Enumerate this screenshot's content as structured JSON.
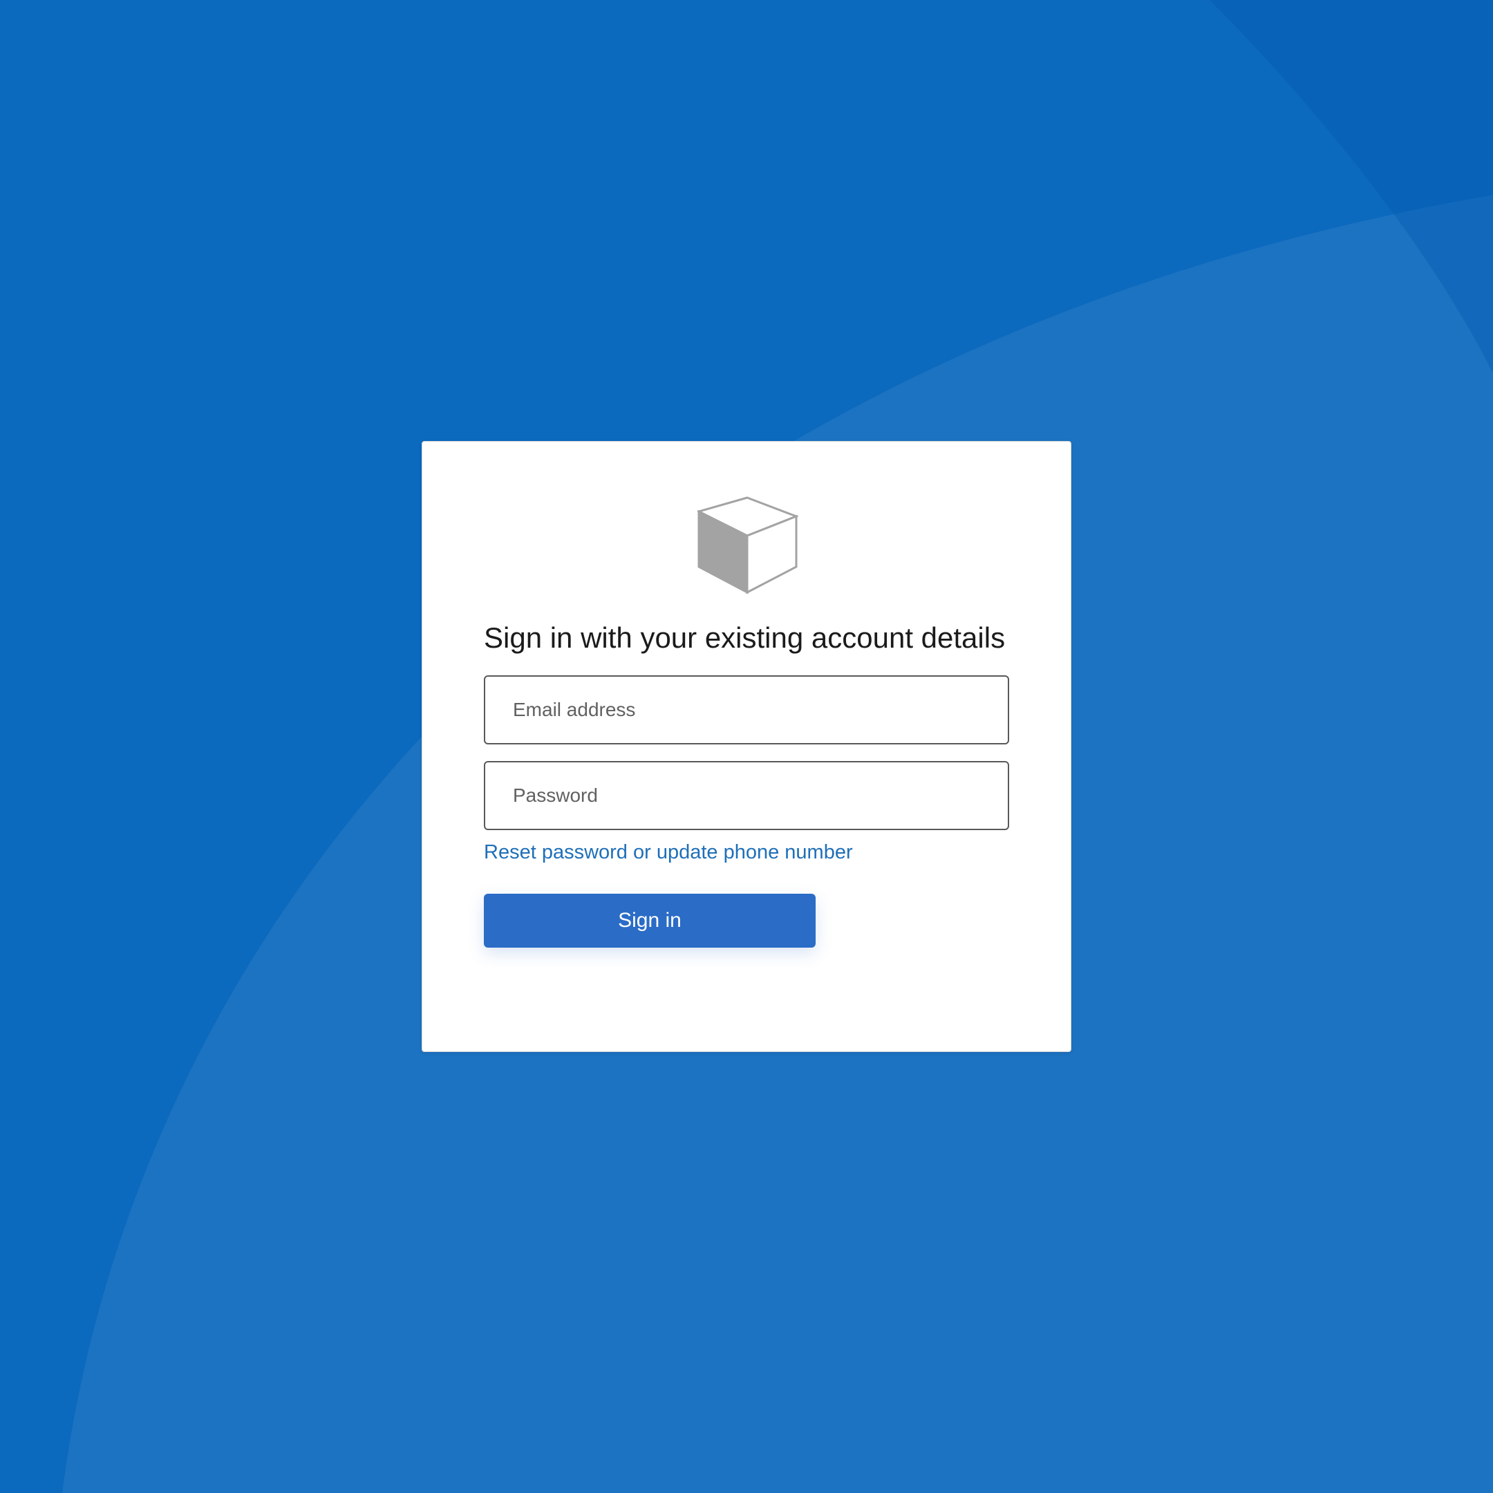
{
  "background": {
    "base_color": "#0b69be",
    "accent_color": "#2a78c2"
  },
  "signin": {
    "logo_icon": "cube-icon",
    "title": "Sign in with your existing account details",
    "email": {
      "placeholder": "Email address",
      "value": ""
    },
    "password": {
      "placeholder": "Password",
      "value": ""
    },
    "reset_link_label": "Reset password or update phone number",
    "submit_label": "Sign in",
    "button_color": "#2a6cc6",
    "link_color": "#1f6fb8"
  }
}
